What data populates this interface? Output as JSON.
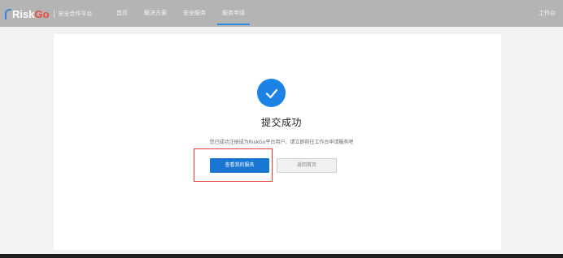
{
  "header": {
    "logo": {
      "brand_prefix": "Risk",
      "brand_suffix": "Go",
      "subtitle": "安全合作平台"
    },
    "nav": [
      {
        "label": "首页"
      },
      {
        "label": "解决方案"
      },
      {
        "label": "安全服务"
      },
      {
        "label": "服务申请"
      }
    ],
    "active_index": 3,
    "workbench_label": "工作台"
  },
  "result": {
    "icon": "check-circle-icon",
    "title": "提交成功",
    "message": "您已成功注册成为RiskGo平台用户，请立即前往工作台申请服务吧",
    "primary_button": "查看我的服务",
    "secondary_button": "返回首页"
  },
  "colors": {
    "topbar": "#b4b4b4",
    "accent": "#1b82e6",
    "primary_button": "#1a76d3",
    "highlight": "#e03b3b"
  }
}
